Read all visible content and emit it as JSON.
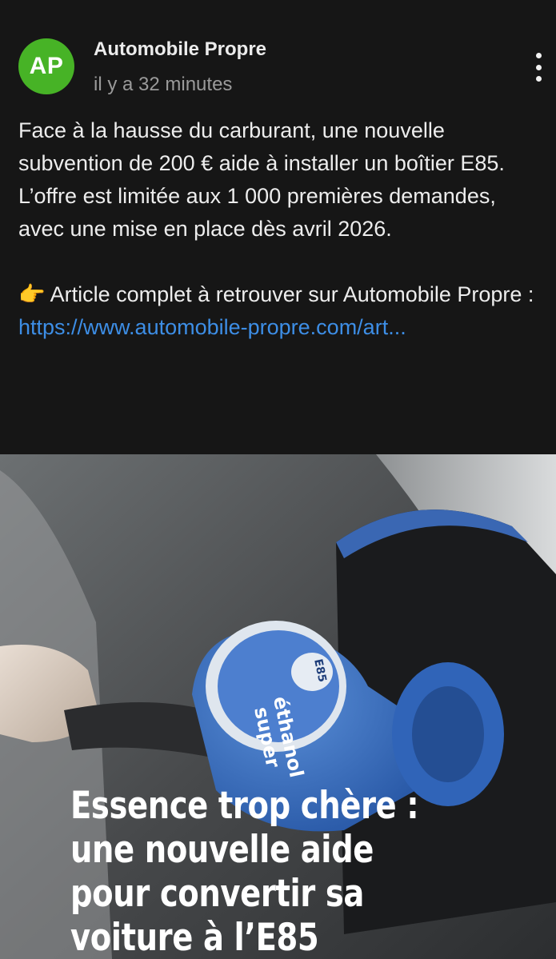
{
  "post": {
    "author": "Automobile Propre",
    "avatar_initials": "AP",
    "avatar_color": "#47b326",
    "timestamp": "il y a 32 minutes",
    "more_icon": "more-vertical-icon",
    "body_lines": {
      "p1": "Face à la hausse du carburant, une nouvelle subvention de 200 € aide à installer un boîtier E85.",
      "p2": "L’offre est limitée aux 1 000 premières demandes, avec une mise en place dès avril 2026."
    },
    "cta_emoji": "👉",
    "cta_text": "Article complet à retrouver sur Automobile Propre :",
    "link_text": "https://www.automobile-propre.com/art...",
    "link_color": "#3d8ee6"
  },
  "media": {
    "nozzle_label_top": "E85",
    "nozzle_label_1": "super",
    "nozzle_label_2": "éthanol",
    "headline_lines": [
      "Essence trop chère :",
      "une nouvelle aide",
      "pour convertir sa",
      "voiture à l’E85"
    ]
  }
}
